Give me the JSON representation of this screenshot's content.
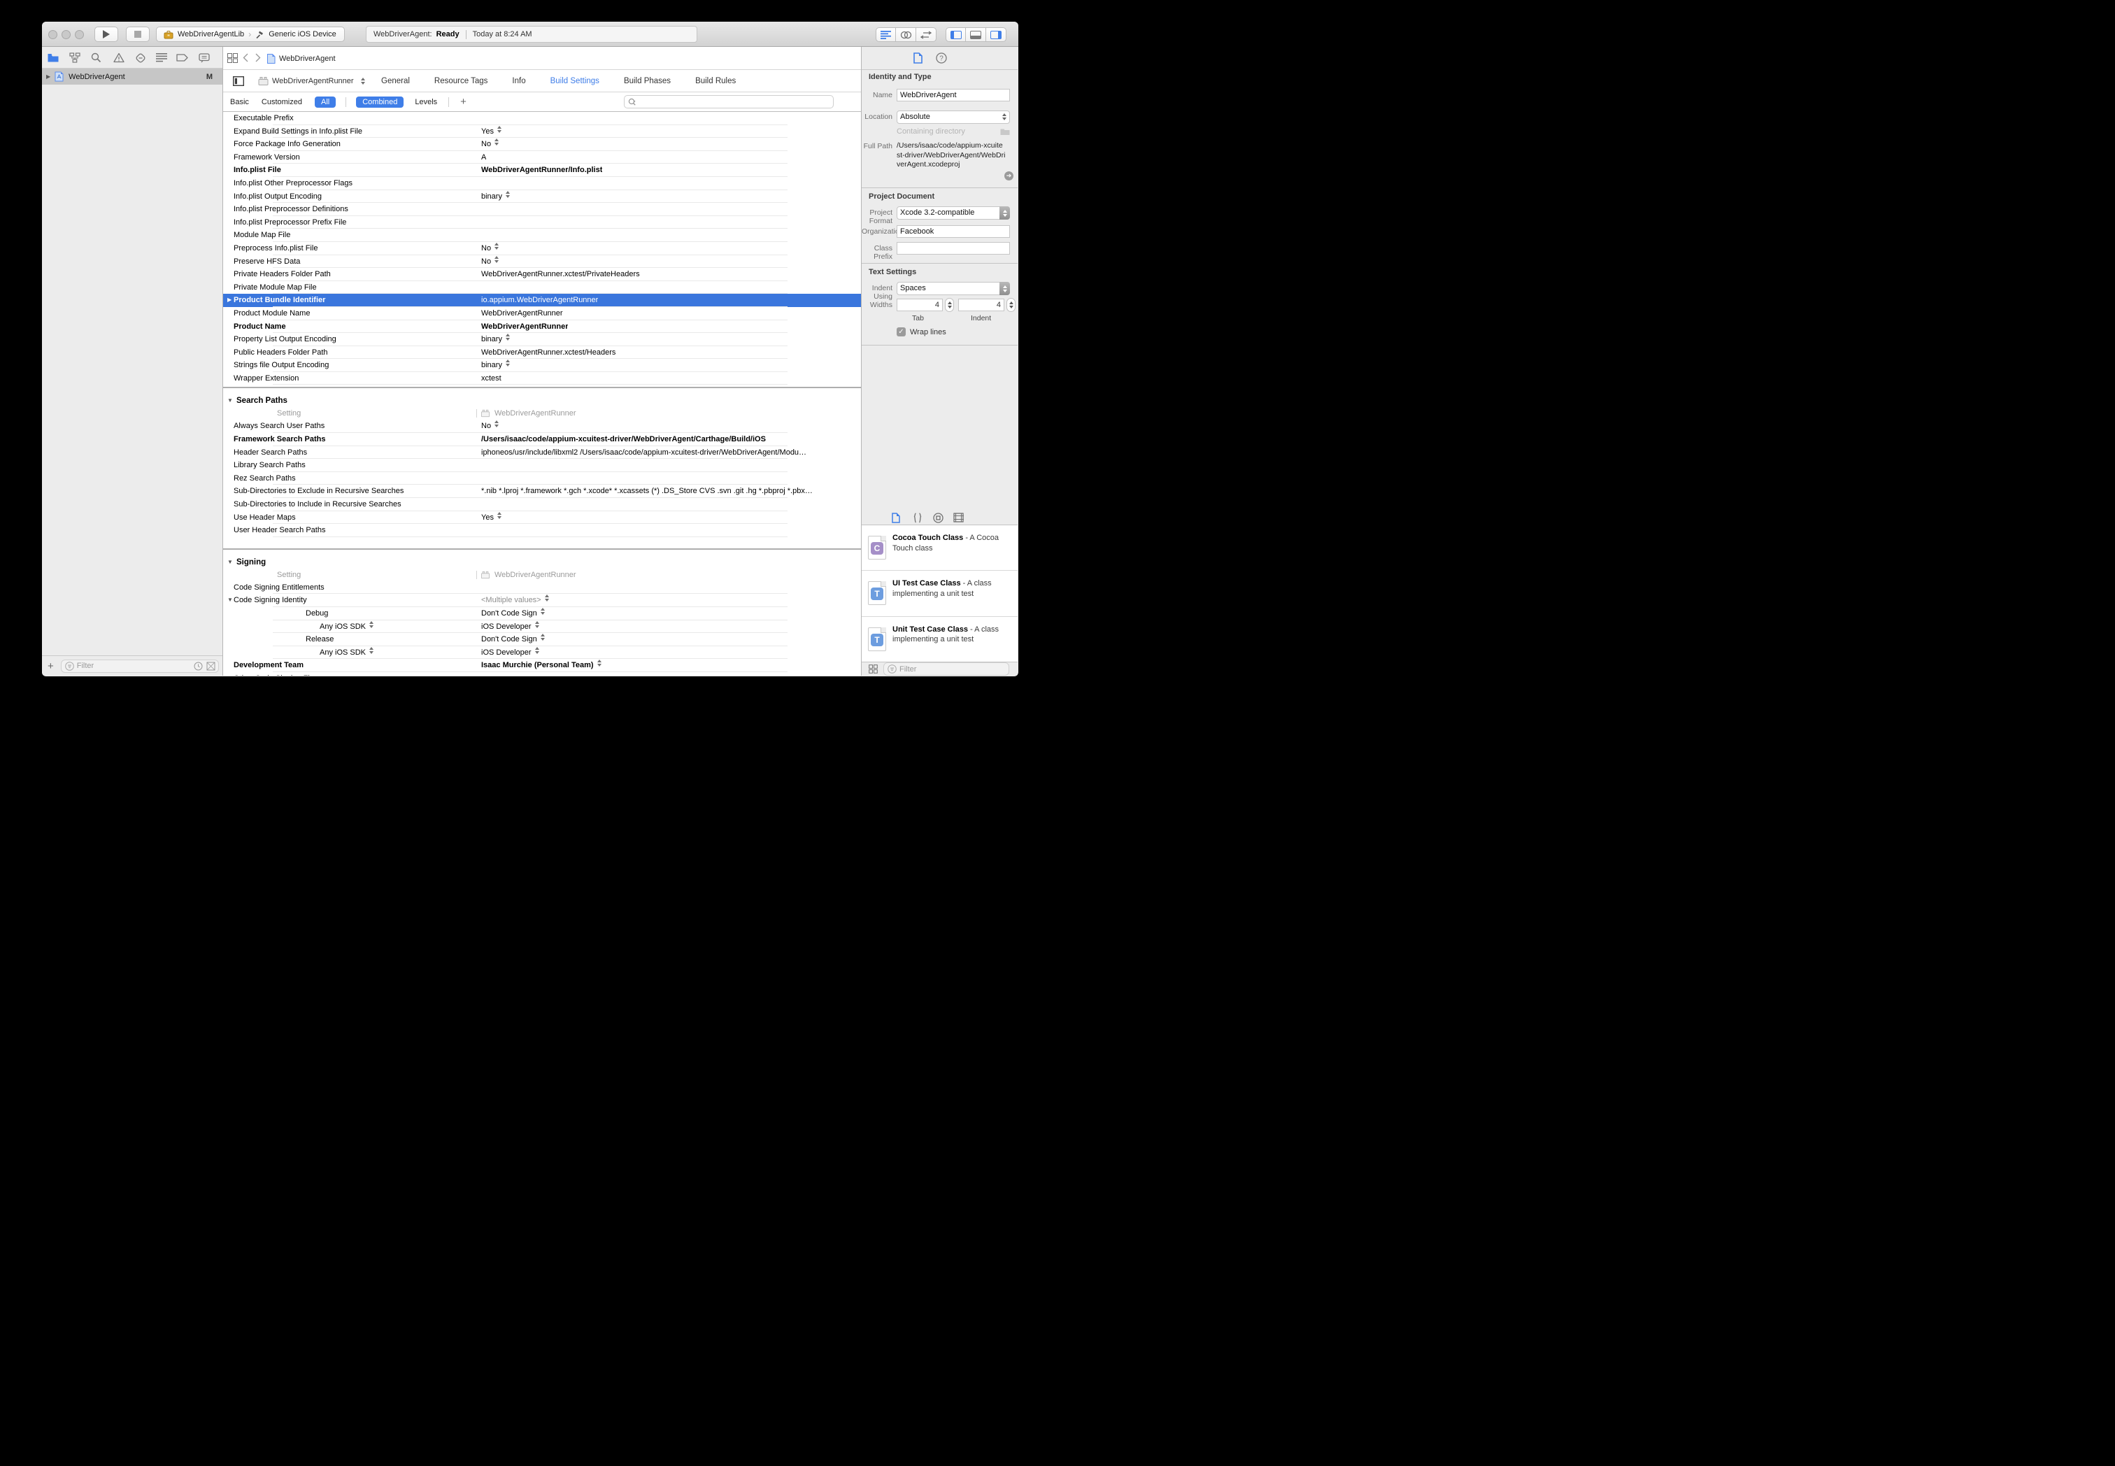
{
  "colors": {
    "accent": "#3f7ee8",
    "selection": "#3a76dd",
    "tab_active": "#3e7de8"
  },
  "toolbar": {
    "scheme": {
      "project": "WebDriverAgentLib",
      "destination": "Generic iOS Device"
    },
    "status": {
      "app": "WebDriverAgent:",
      "state": "Ready",
      "time": "Today at 8:24 AM"
    }
  },
  "navigator": {
    "project": {
      "name": "WebDriverAgent",
      "badge": "M"
    },
    "filter_placeholder": "Filter",
    "add_label": "+"
  },
  "editor": {
    "jumpbar_title": "WebDriverAgent",
    "target": "WebDriverAgentRunner",
    "tabs": [
      {
        "label": "General"
      },
      {
        "label": "Resource Tags"
      },
      {
        "label": "Info"
      },
      {
        "label": "Build Settings",
        "active": true
      },
      {
        "label": "Build Phases"
      },
      {
        "label": "Build Rules"
      }
    ],
    "scopes": [
      {
        "label": "Basic"
      },
      {
        "label": "Customized"
      },
      {
        "label": "All",
        "pill": true
      }
    ],
    "modes": [
      {
        "label": "Combined",
        "pill": true
      },
      {
        "label": "Levels"
      }
    ],
    "add_label": "+",
    "sections": [
      {
        "rows": [
          {
            "name": "Executable Prefix"
          },
          {
            "name": "Expand Build Settings in Info.plist File",
            "value": "Yes",
            "dd": true
          },
          {
            "name": "Force Package Info Generation",
            "value": "No",
            "dd": true
          },
          {
            "name": "Framework Version",
            "value": "A"
          },
          {
            "name": "Info.plist File",
            "bold": true,
            "value": "WebDriverAgentRunner/Info.plist",
            "value_bold": true
          },
          {
            "name": "Info.plist Other Preprocessor Flags"
          },
          {
            "name": "Info.plist Output Encoding",
            "value": "binary",
            "dd": true
          },
          {
            "name": "Info.plist Preprocessor Definitions"
          },
          {
            "name": "Info.plist Preprocessor Prefix File"
          },
          {
            "name": "Module Map File"
          },
          {
            "name": "Preprocess Info.plist File",
            "value": "No",
            "dd": true
          },
          {
            "name": "Preserve HFS Data",
            "value": "No",
            "dd": true
          },
          {
            "name": "Private Headers Folder Path",
            "value": "WebDriverAgentRunner.xctest/PrivateHeaders"
          },
          {
            "name": "Private Module Map File"
          },
          {
            "name": "Product Bundle Identifier",
            "bold": true,
            "selected": true,
            "disclosure": "right",
            "value": "io.appium.WebDriverAgentRunner"
          },
          {
            "name": "Product Module Name",
            "value": "WebDriverAgentRunner"
          },
          {
            "name": "Product Name",
            "bold": true,
            "value": "WebDriverAgentRunner",
            "value_bold": true
          },
          {
            "name": "Property List Output Encoding",
            "value": "binary",
            "dd": true
          },
          {
            "name": "Public Headers Folder Path",
            "value": "WebDriverAgentRunner.xctest/Headers"
          },
          {
            "name": "Strings file Output Encoding",
            "value": "binary",
            "dd": true
          },
          {
            "name": "Wrapper Extension",
            "value": "xctest"
          }
        ]
      },
      {
        "title": "Search Paths",
        "header_setting": "Setting",
        "header_target": "WebDriverAgentRunner",
        "rows": [
          {
            "name": "Always Search User Paths",
            "value": "No",
            "dd": true
          },
          {
            "name": "Framework Search Paths",
            "bold": true,
            "value": "/Users/isaac/code/appium-xcuitest-driver/WebDriverAgent/Carthage/Build/iOS",
            "value_bold": true
          },
          {
            "name": "Header Search Paths",
            "value": "iphoneos/usr/include/libxml2 /Users/isaac/code/appium-xcuitest-driver/WebDriverAgent/Modu…"
          },
          {
            "name": "Library Search Paths"
          },
          {
            "name": "Rez Search Paths"
          },
          {
            "name": "Sub-Directories to Exclude in Recursive Searches",
            "value": "*.nib *.lproj *.framework *.gch *.xcode* *.xcassets (*) .DS_Store CVS .svn .git .hg *.pbproj *.pbx…"
          },
          {
            "name": "Sub-Directories to Include in Recursive Searches"
          },
          {
            "name": "Use Header Maps",
            "value": "Yes",
            "dd": true
          },
          {
            "name": "User Header Search Paths"
          }
        ]
      },
      {
        "title": "Signing",
        "header_setting": "Setting",
        "header_target": "WebDriverAgentRunner",
        "rows": [
          {
            "name": "Code Signing Entitlements"
          },
          {
            "name": "Code Signing Identity",
            "disclosure": "down",
            "value": "<Multiple values>",
            "dd": true,
            "value_muted": true
          },
          {
            "name": "Debug",
            "indent": 1,
            "value": "Don't Code Sign",
            "dd": true
          },
          {
            "name": "Any iOS SDK",
            "indent": 2,
            "name_dd": true,
            "value": "iOS Developer",
            "dd": true
          },
          {
            "name": "Release",
            "indent": 1,
            "value": "Don't Code Sign",
            "dd": true
          },
          {
            "name": "Any iOS SDK",
            "indent": 2,
            "name_dd": true,
            "value": "iOS Developer",
            "dd": true
          },
          {
            "name": "Development Team",
            "bold": true,
            "value": "Isaac Murchie (Personal Team)",
            "dd": true,
            "value_bold": true
          },
          {
            "name": "Other Code Signing Flags"
          }
        ]
      }
    ]
  },
  "inspector": {
    "identity": {
      "title": "Identity and Type",
      "name_label": "Name",
      "name_value": "WebDriverAgent",
      "location_label": "Location",
      "location_value": "Absolute",
      "containing": "Containing directory",
      "full_path_label": "Full Path",
      "full_path": "/Users/isaac/code/appium-xcuitest-driver/WebDriverAgent/WebDriverAgent.xcodeproj"
    },
    "project_document": {
      "title": "Project Document",
      "format_label": "Project Format",
      "format_value": "Xcode 3.2-compatible",
      "organization_label": "Organization",
      "organization_value": "Facebook",
      "class_prefix_label": "Class Prefix",
      "class_prefix_value": ""
    },
    "text_settings": {
      "title": "Text Settings",
      "indent_label": "Indent Using",
      "indent_value": "Spaces",
      "widths_label": "Widths",
      "tab_width": "4",
      "indent_width": "4",
      "tab_sublabel": "Tab",
      "indent_sublabel": "Indent",
      "wrap_label": "Wrap lines",
      "wrap_checked": true
    }
  },
  "library": {
    "cards": [
      {
        "letter": "C",
        "color": "#a58fc8",
        "title": "Cocoa Touch Class",
        "desc": "A Cocoa Touch class"
      },
      {
        "letter": "T",
        "color": "#6d9ddf",
        "title": "UI Test Case Class",
        "desc": "A class implementing a unit test"
      },
      {
        "letter": "T",
        "color": "#6d9ddf",
        "title": "Unit Test Case Class",
        "desc": "A class implementing a unit test"
      }
    ],
    "filter_placeholder": "Filter"
  },
  "icons": [
    "run-icon",
    "stop-icon",
    "toolbox-icon",
    "hammer-icon",
    "standard-editor-icon",
    "assistant-editor-icon",
    "version-editor-icon",
    "navigator-panel-icon",
    "debug-panel-icon",
    "inspector-panel-icon",
    "project-navigator-icon",
    "symbol-navigator-icon",
    "search-navigator-icon",
    "issue-navigator-icon",
    "test-navigator-icon",
    "debug-navigator-icon",
    "breakpoint-navigator-icon",
    "report-navigator-icon",
    "grid-icon",
    "back-icon",
    "forward-icon",
    "app-icon",
    "target-icon",
    "search-icon",
    "file-inspector-icon",
    "quick-help-icon",
    "folder-icon",
    "jump-arrow-icon",
    "file-template-icon",
    "snippet-icon",
    "object-icon",
    "media-icon",
    "filter-icon",
    "clock-icon",
    "flag-box-icon",
    "plus-icon"
  ]
}
